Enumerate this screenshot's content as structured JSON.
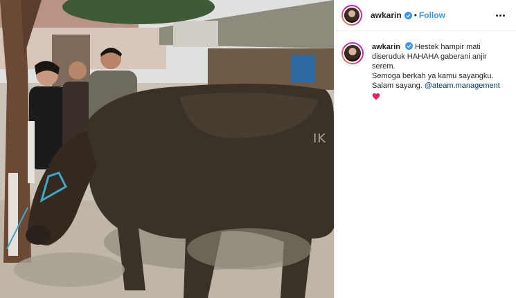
{
  "post": {
    "username": "awkarin",
    "follow_label": "Follow",
    "separator": "•",
    "photo_watermark": "IK"
  },
  "caption": {
    "username": "awkarin",
    "line1": "Hestek hampir mati diseruduk HAHAHA gaberani anjir serem.",
    "line2": "Semoga berkah ya kamu sayangku.",
    "line3_prefix": "Salam sayang.",
    "mention": "@ateam.management",
    "emoji": "red-heart"
  },
  "colors": {
    "follow": "#3897f0",
    "verified": "#3897f0",
    "mention": "#00376b",
    "heart": "#e0245e",
    "avatar_ring_start": "#f9a03c",
    "avatar_ring_end": "#b42fc6"
  }
}
